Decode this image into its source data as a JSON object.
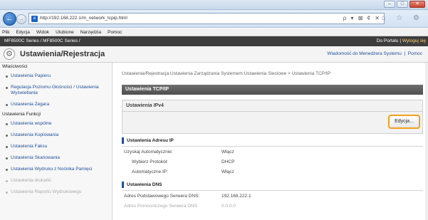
{
  "browser": {
    "url": "http://192.168.222.1/m_network_tcpip.html",
    "window_buttons": [
      "–",
      "□",
      "✕"
    ],
    "url_controls": "ρ ▾ ⊠ ¢ ✕",
    "right_icons": "⌂ ☆ ⚙"
  },
  "menu": [
    "Plik",
    "Edycja",
    "Widok",
    "Ulubione",
    "Narzędzia",
    "Pomoc"
  ],
  "device": {
    "model": "MF8500C Series / MF8500C Series /",
    "portal_link": "Do Portalu",
    "logout": "Wyloguj się"
  },
  "header": {
    "title": "Ustawienia/Rejestracja",
    "admin_link": "Wiadomość do Menedżera Systemu",
    "help": "Pomoc"
  },
  "sidebar": {
    "header1": "Właściwości",
    "group1": [
      "Ustawienia Papieru",
      "Regulacja Poziomu Głośności / Ustawienia Wyświetlania",
      "Ustawienia Zegara"
    ],
    "header2": "Ustawienia Funkcji",
    "group2": [
      "Ustawienia wspólne",
      "Ustawienia Kopiowania",
      "Ustawienia Faksu",
      "Ustawienia Skanowania",
      "Ustawienia Wydruku z Nośnika Pamięci",
      "Ustawienia drukarki",
      "Ustawienia Raportu Wydrukowego"
    ]
  },
  "content": {
    "breadcrumb": "Ustawienia/Rejestracja:Ustawienia Zarządzania Systemem:Ustawienia Sieciowe > Ustawienia TCP/IP",
    "section_title": "Ustawienia TCP/IP",
    "ipv4_title": "Ustawienia IPv4",
    "edit_button": "Edycja...",
    "ip_section": "Ustawienia Adresu IP",
    "ip_rows": [
      {
        "label": "Uzyskaj Automatycznie:",
        "value": "Włącz"
      },
      {
        "label": "Wybierz Protokół:",
        "value": "DHCP"
      },
      {
        "label": "Automatyczne IP:",
        "value": "Włącz"
      }
    ],
    "dns_section": "Ustawienia DNS",
    "dns_rows": [
      {
        "label": "Adres Podstawowego Serwera DNS:",
        "value": "192.168.222.1"
      },
      {
        "label": "Adres Pomocniczego Serwera DNS:",
        "value": "0.0.0.0"
      }
    ]
  }
}
